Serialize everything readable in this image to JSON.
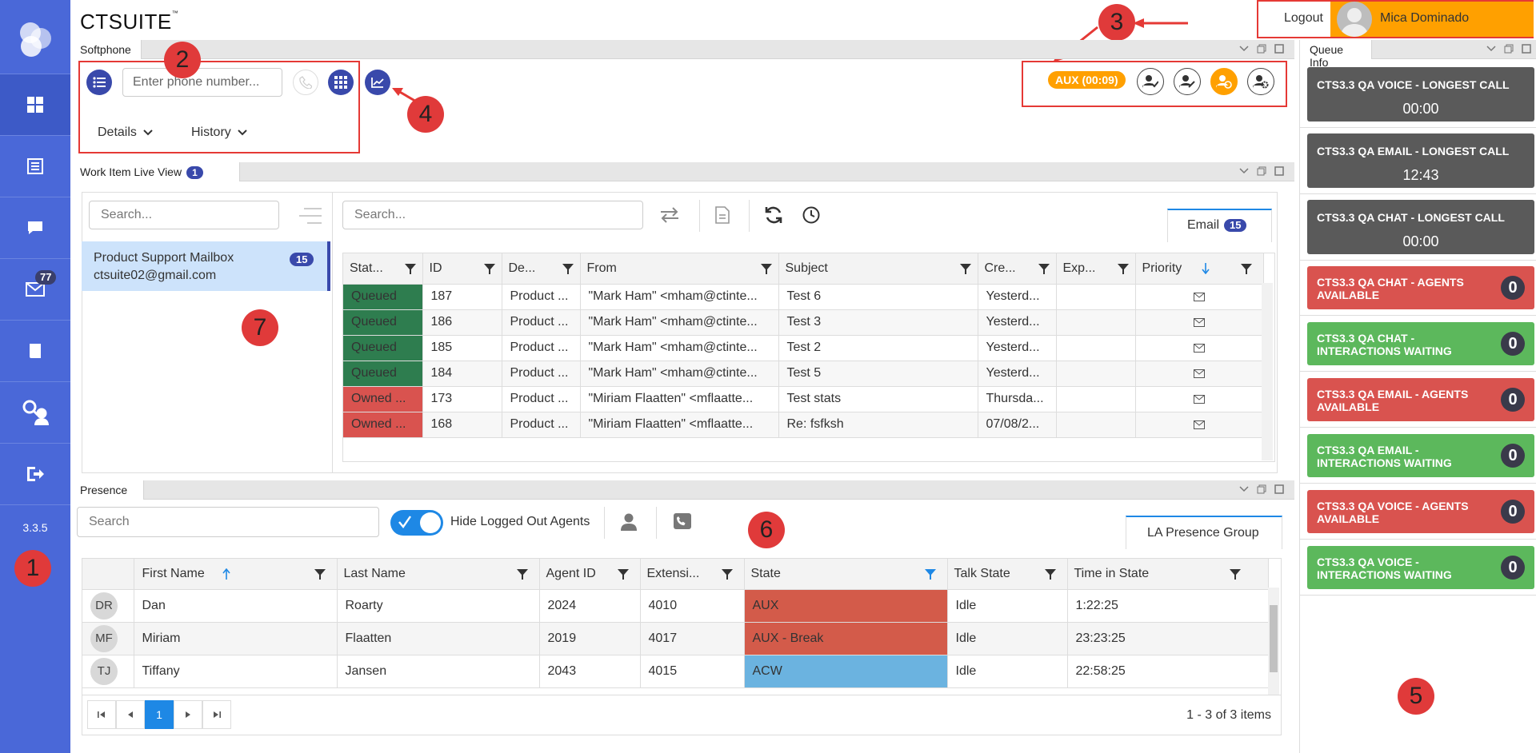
{
  "app": {
    "brand": "CTSUITE",
    "version": "3.3.5"
  },
  "nav": {
    "mail_badge": "77"
  },
  "annotations": [
    "1",
    "2",
    "3",
    "4",
    "5",
    "6",
    "7"
  ],
  "header": {
    "logout": "Logout",
    "user_name": "Mica Dominado"
  },
  "softphone": {
    "tab": "Softphone",
    "phone_placeholder": "Enter phone number...",
    "details": "Details",
    "history": "History",
    "aux_status": "AUX (00:09)"
  },
  "workitem": {
    "tab": "Work Item Live View",
    "tab_count": "1",
    "left_search_placeholder": "Search...",
    "right_search_placeholder": "Search...",
    "mailbox": {
      "name": "Product Support Mailbox",
      "email": "ctsuite02@gmail.com",
      "count": "15"
    },
    "email_tab": "Email",
    "email_count": "15",
    "columns": [
      "Stat...",
      "ID",
      "De...",
      "From",
      "Subject",
      "Cre...",
      "Exp...",
      "Priority"
    ],
    "rows": [
      {
        "status": "Queued",
        "id": "187",
        "dept": "Product ...",
        "from": "\"Mark Ham\" <mham@ctinte...",
        "subject": "Test 6",
        "created": "Yesterd...",
        "exp": ""
      },
      {
        "status": "Queued",
        "id": "186",
        "dept": "Product ...",
        "from": "\"Mark Ham\" <mham@ctinte...",
        "subject": "Test 3",
        "created": "Yesterd...",
        "exp": ""
      },
      {
        "status": "Queued",
        "id": "185",
        "dept": "Product ...",
        "from": "\"Mark Ham\" <mham@ctinte...",
        "subject": "Test 2",
        "created": "Yesterd...",
        "exp": ""
      },
      {
        "status": "Queued",
        "id": "184",
        "dept": "Product ...",
        "from": "\"Mark Ham\" <mham@ctinte...",
        "subject": "Test 5",
        "created": "Yesterd...",
        "exp": ""
      },
      {
        "status": "Owned ...",
        "id": "173",
        "dept": "Product ...",
        "from": "\"Miriam Flaatten\" <mflaatte...",
        "subject": "Test stats",
        "created": "Thursda...",
        "exp": ""
      },
      {
        "status": "Owned ...",
        "id": "168",
        "dept": "Product ...",
        "from": "\"Miriam Flaatten\" <mflaatte...",
        "subject": "Re: fsfksh",
        "created": "07/08/2...",
        "exp": ""
      }
    ]
  },
  "presence": {
    "tab": "Presence",
    "search_placeholder": "Search",
    "hide_logged_out": "Hide Logged Out Agents",
    "group_tab": "LA Presence Group",
    "columns": [
      "First Name",
      "Last Name",
      "Agent ID",
      "Extensi...",
      "State",
      "Talk State",
      "Time in State"
    ],
    "rows": [
      {
        "initials": "DR",
        "first": "Dan",
        "last": "Roarty",
        "agent_id": "2024",
        "ext": "4010",
        "state": "AUX",
        "state_color": "#d35b4a",
        "talk": "Idle",
        "time": "1:22:25"
      },
      {
        "initials": "MF",
        "first": "Miriam",
        "last": "Flaatten",
        "agent_id": "2019",
        "ext": "4017",
        "state": "AUX - Break",
        "state_color": "#d35b4a",
        "talk": "Idle",
        "time": "23:23:25"
      },
      {
        "initials": "TJ",
        "first": "Tiffany",
        "last": "Jansen",
        "agent_id": "2043",
        "ext": "4015",
        "state": "ACW",
        "state_color": "#6bb3e0",
        "talk": "Idle",
        "time": "22:58:25"
      }
    ],
    "page": "1",
    "summary": "1 - 3 of 3 items"
  },
  "queue": {
    "tab": "Queue Info",
    "cards": [
      {
        "title": "CTS3.3 QA VOICE - LONGEST CALL",
        "value": "00:00",
        "kind": "dark"
      },
      {
        "title": "CTS3.3 QA EMAIL - LONGEST CALL",
        "value": "12:43",
        "kind": "dark"
      },
      {
        "title": "CTS3.3 QA CHAT - LONGEST CALL",
        "value": "00:00",
        "kind": "dark"
      },
      {
        "title": "CTS3.3 QA CHAT - AGENTS AVAILABLE",
        "value": "0",
        "kind": "red"
      },
      {
        "title": "CTS3.3 QA CHAT - INTERACTIONS WAITING",
        "value": "0",
        "kind": "green"
      },
      {
        "title": "CTS3.3 QA EMAIL - AGENTS AVAILABLE",
        "value": "0",
        "kind": "red"
      },
      {
        "title": "CTS3.3 QA EMAIL - INTERACTIONS WAITING",
        "value": "0",
        "kind": "green"
      },
      {
        "title": "CTS3.3 QA VOICE - AGENTS AVAILABLE",
        "value": "0",
        "kind": "red"
      },
      {
        "title": "CTS3.3 QA VOICE - INTERACTIONS WAITING",
        "value": "0",
        "kind": "green"
      }
    ]
  },
  "colors": {
    "sidebar": "#4a68d8",
    "accent": "#3949ab",
    "queued": "#2e7d4f",
    "owned": "#d9534f",
    "aux_orange": "#ffa000",
    "annotation": "#e03a3a"
  }
}
